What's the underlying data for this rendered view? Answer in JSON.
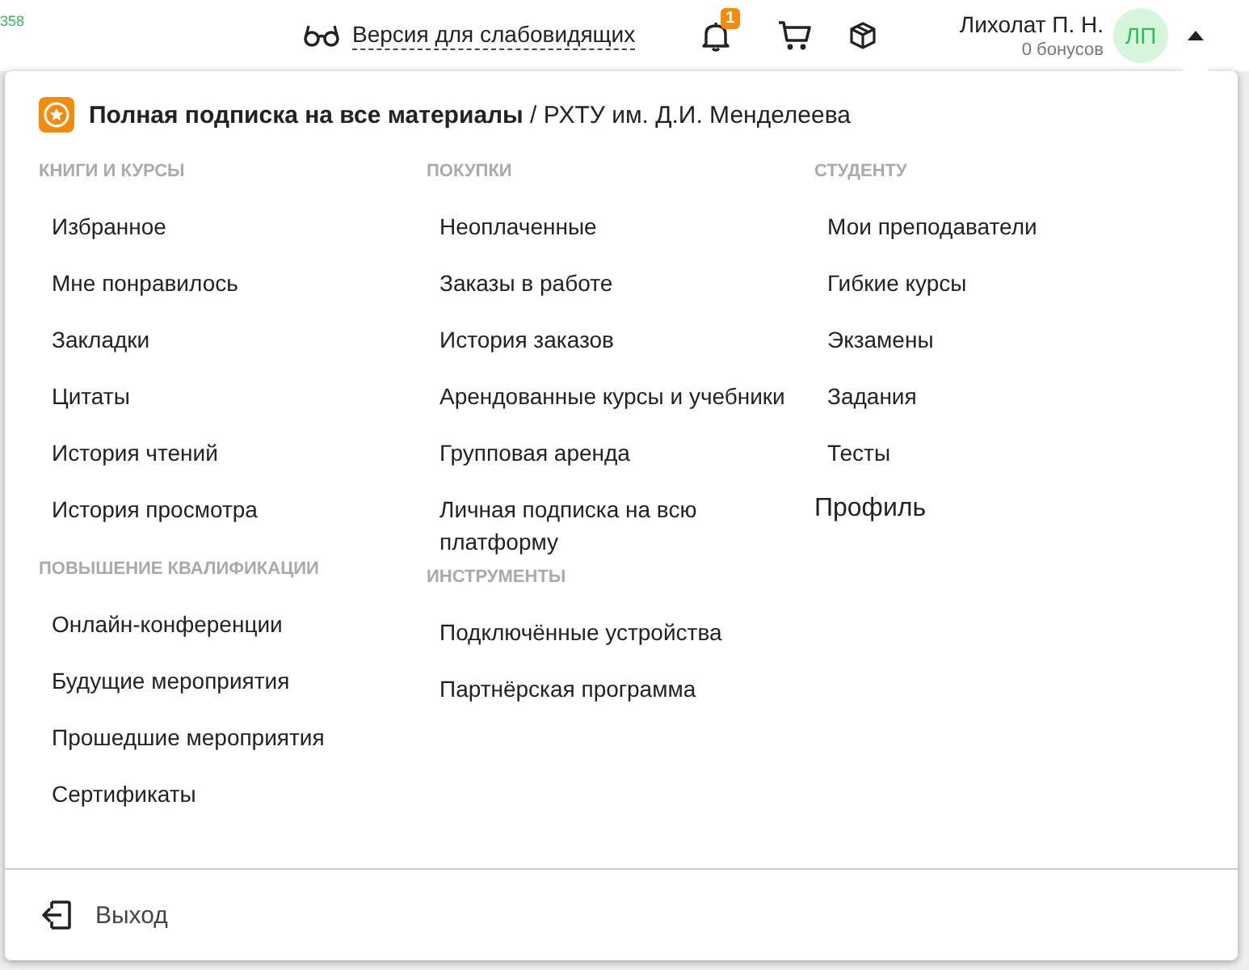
{
  "corner_text": "358",
  "header": {
    "accessibility_link": "Версия для слабовидящих",
    "notifications_badge": "1",
    "user": {
      "name": "Лихолат П. Н.",
      "bonus": "0 бонусов",
      "initials": "ЛП"
    }
  },
  "menu": {
    "subscription": {
      "title": "Полная подписка на все материалы",
      "organization": " / РХТУ им. Д.И. Менделеева"
    },
    "columns": [
      {
        "groups": [
          {
            "title": "КНИГИ И КУРСЫ",
            "items": [
              {
                "label": "Избранное",
                "kind": "link"
              },
              {
                "label": "Мне понравилось",
                "kind": "link"
              },
              {
                "label": "Закладки",
                "kind": "link"
              },
              {
                "label": "Цитаты",
                "kind": "link"
              },
              {
                "label": "История чтений",
                "kind": "link"
              },
              {
                "label": "История просмотра",
                "kind": "link"
              }
            ]
          },
          {
            "title": "ПОВЫШЕНИЕ КВАЛИФИКАЦИИ",
            "items": [
              {
                "label": "Онлайн-конференции",
                "kind": "link"
              },
              {
                "label": "Будущие мероприятия",
                "kind": "link"
              },
              {
                "label": "Прошедшие мероприятия",
                "kind": "link"
              },
              {
                "label": "Сертификаты",
                "kind": "link"
              }
            ]
          }
        ]
      },
      {
        "groups": [
          {
            "title": "ПОКУПКИ",
            "items": [
              {
                "label": "Неоплаченные",
                "kind": "link"
              },
              {
                "label": "Заказы в работе",
                "kind": "link"
              },
              {
                "label": "История заказов",
                "kind": "link"
              },
              {
                "label": "Арендованные курсы и учебники",
                "kind": "link"
              },
              {
                "label": "Групповая аренда",
                "kind": "link"
              },
              {
                "label": "Личная подписка на всю платформу",
                "kind": "link"
              }
            ]
          },
          {
            "title": "ИНСТРУМЕНТЫ",
            "items": [
              {
                "label": "Подключённые устройства",
                "kind": "link"
              },
              {
                "label": "Партнёрская программа",
                "kind": "link"
              }
            ]
          }
        ]
      },
      {
        "groups": [
          {
            "title": "СТУДЕНТУ",
            "items": [
              {
                "label": "Мои преподаватели",
                "kind": "link"
              },
              {
                "label": "Гибкие курсы",
                "kind": "link"
              },
              {
                "label": "Экзамены",
                "kind": "link"
              },
              {
                "label": "Задания",
                "kind": "link"
              },
              {
                "label": "Тесты",
                "kind": "link"
              },
              {
                "label": "Профиль",
                "kind": "primary"
              }
            ]
          }
        ]
      }
    ],
    "logout": "Выход"
  }
}
